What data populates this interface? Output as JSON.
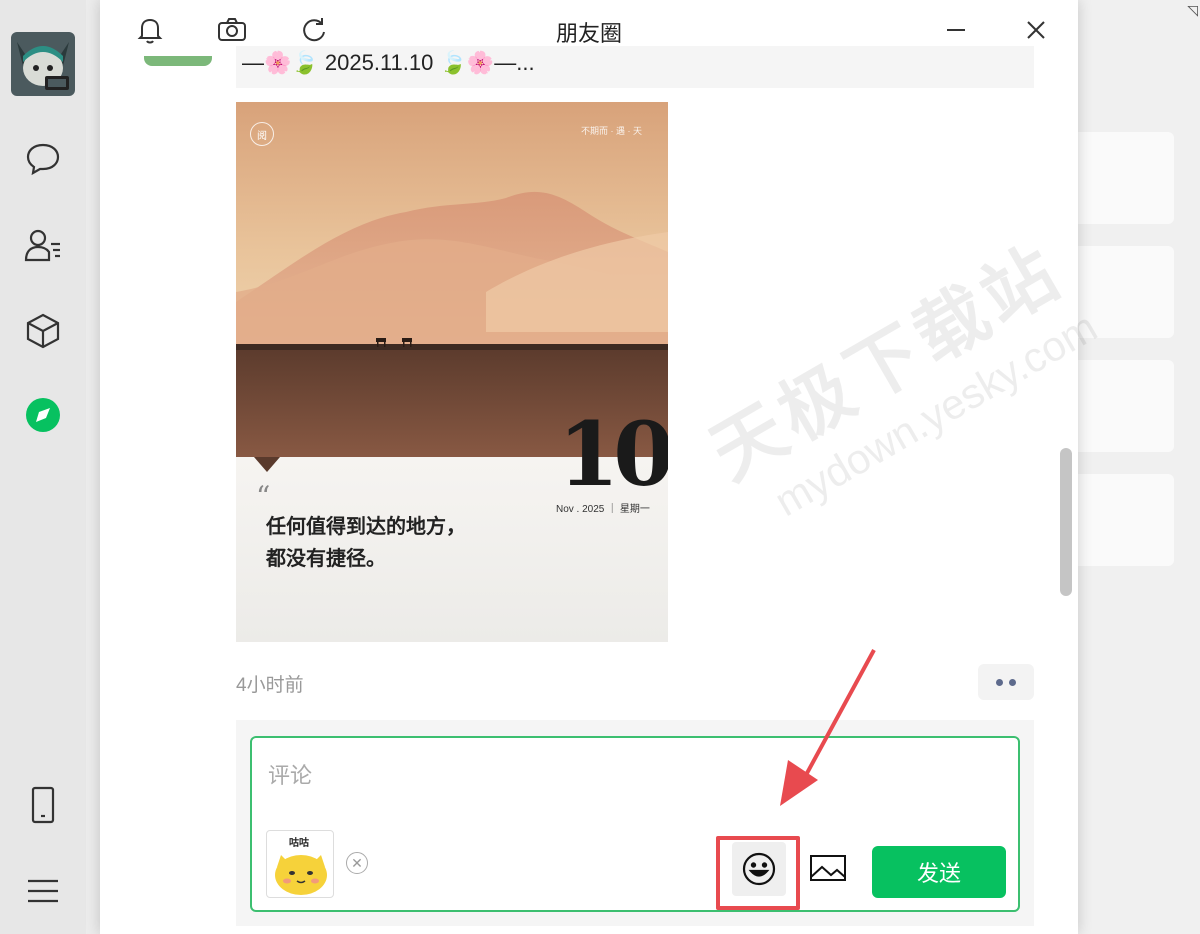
{
  "window": {
    "title": "朋友圈"
  },
  "post": {
    "text": "—🌸🍃 2025.11.10 🍃🌸—...",
    "image": {
      "quote_line1": "任何值得到达的地方，",
      "quote_line2": "都没有捷径。",
      "day": "10",
      "date_caption": "Nov . 2025 ｜ 星期一",
      "top_right": "不期而 · 遇 · 天",
      "logo": "阅"
    },
    "time": "4小时前"
  },
  "comment": {
    "placeholder": "评论",
    "sticker_text": "咕咕",
    "send_label": "发送"
  },
  "watermark": {
    "line1": "天极下载站",
    "line2": "mydown.yesky.com"
  },
  "colors": {
    "accent_green": "#07c160",
    "input_border": "#3cbf70",
    "highlight_red": "#e84a4f"
  },
  "icons": {
    "rail": [
      "chat-icon",
      "contacts-icon",
      "cube-icon",
      "moments-compass-icon",
      "phone-icon",
      "menu-icon"
    ],
    "titlebar": [
      "bell-icon",
      "camera-icon",
      "refresh-icon",
      "minimize-icon",
      "close-icon"
    ]
  }
}
